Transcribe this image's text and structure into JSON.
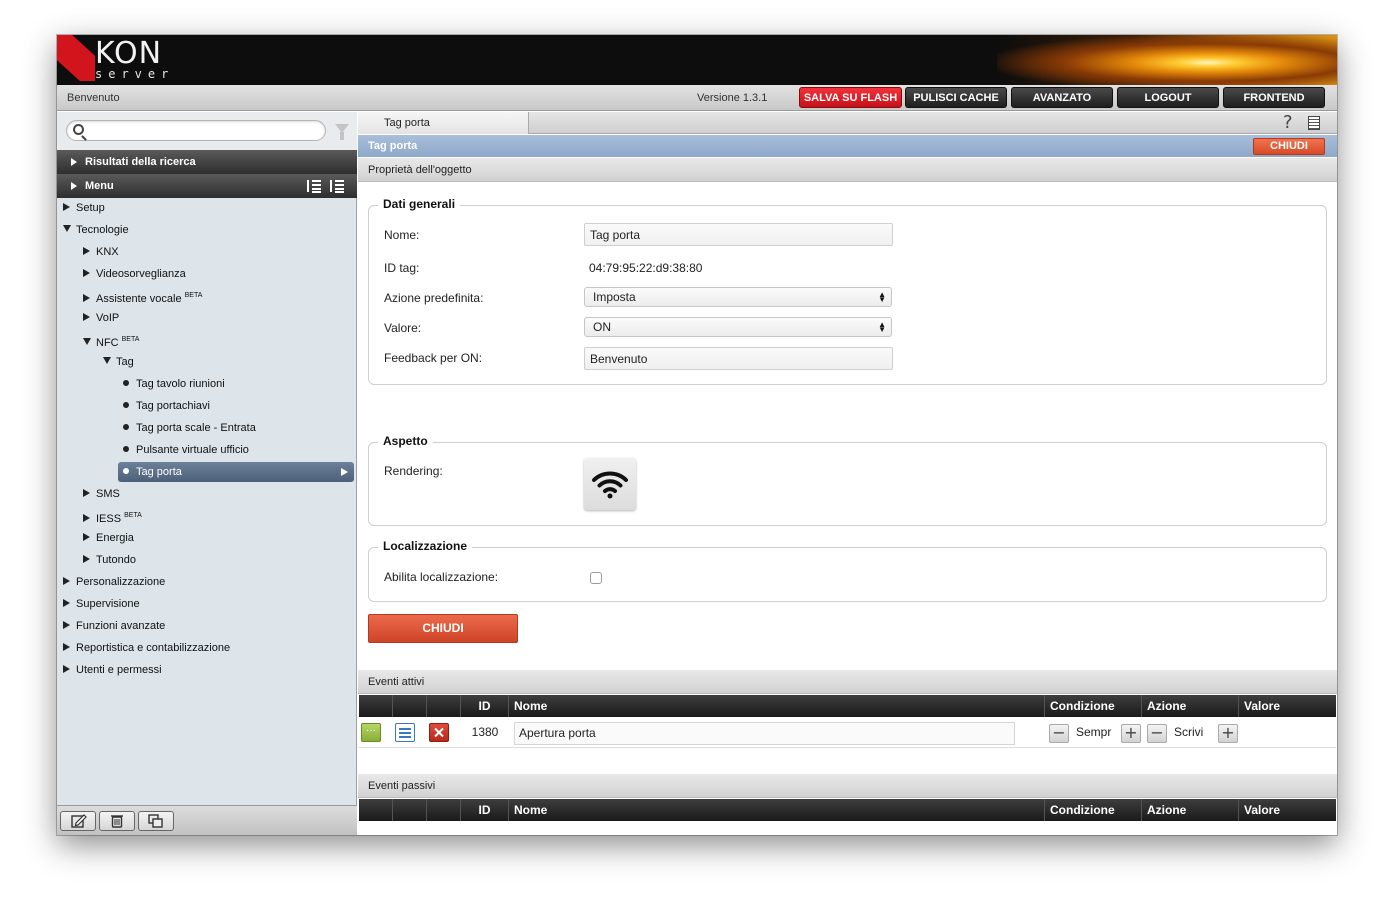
{
  "header": {
    "logo_text": "KON",
    "logo_sub": "server",
    "welcome": "Benvenuto",
    "version": "Versione 1.3.1",
    "buttons": {
      "save_flash": "SALVA SU FLASH",
      "clear_cache": "PULISCI CACHE",
      "advanced": "AVANZATO",
      "logout": "LOGOUT",
      "frontend": "FRONTEND"
    }
  },
  "sidebar": {
    "search_placeholder": "",
    "search_results": "Risultati della ricerca",
    "menu": "Menu",
    "tree": [
      {
        "label": "Setup",
        "sup": ""
      },
      {
        "label": "Tecnologie",
        "sup": ""
      },
      {
        "label": "KNX",
        "sup": ""
      },
      {
        "label": "Videosorveglianza",
        "sup": ""
      },
      {
        "label": "Assistente vocale",
        "sup": "BETA"
      },
      {
        "label": "VoIP",
        "sup": ""
      },
      {
        "label": "NFC",
        "sup": "BETA"
      },
      {
        "label": "Tag",
        "sup": ""
      },
      {
        "label": "Tag tavolo riunioni",
        "sup": ""
      },
      {
        "label": "Tag portachiavi",
        "sup": ""
      },
      {
        "label": "Tag porta scale - Entrata",
        "sup": ""
      },
      {
        "label": "Pulsante virtuale ufficio",
        "sup": ""
      },
      {
        "label": "Tag porta",
        "sup": ""
      },
      {
        "label": "SMS",
        "sup": ""
      },
      {
        "label": "IESS",
        "sup": "BETA"
      },
      {
        "label": "Energia",
        "sup": ""
      },
      {
        "label": "Tutondo",
        "sup": ""
      },
      {
        "label": "Personalizzazione",
        "sup": ""
      },
      {
        "label": "Supervisione",
        "sup": ""
      },
      {
        "label": "Funzioni avanzate",
        "sup": ""
      },
      {
        "label": "Reportistica e contabilizzazione",
        "sup": ""
      },
      {
        "label": "Utenti e permessi",
        "sup": ""
      }
    ]
  },
  "main": {
    "tab": "Tag porta",
    "help": "?",
    "title": "Tag porta",
    "close_small": "CHIUDI",
    "properties": "Proprietà dell'oggetto",
    "general": {
      "legend": "Dati generali",
      "name_label": "Nome:",
      "name_value": "Tag porta",
      "id_label": "ID tag:",
      "id_value": "04:79:95:22:d9:38:80",
      "action_label": "Azione predefinita:",
      "action_value": "Imposta",
      "value_label": "Valore:",
      "value_value": "ON",
      "feedback_label": "Feedback per ON:",
      "feedback_value": "Benvenuto"
    },
    "aspect": {
      "legend": "Aspetto",
      "rendering_label": "Rendering:",
      "rendering_icon": "wifi-icon"
    },
    "location": {
      "legend": "Localizzazione",
      "enable_label": "Abilita localizzazione:",
      "enabled": false
    },
    "close_big": "CHIUDI",
    "active_events": {
      "title": "Eventi attivi",
      "columns": [
        "ID",
        "Nome",
        "Condizione",
        "Azione",
        "Valore"
      ],
      "rows": [
        {
          "id": "1380",
          "name": "Apertura porta",
          "condition": "Sempr",
          "action": "Scrivi",
          "value": ""
        }
      ]
    },
    "passive_events": {
      "title": "Eventi passivi",
      "columns": [
        "ID",
        "Nome",
        "Condizione",
        "Azione",
        "Valore"
      ]
    }
  },
  "colors": {
    "brand_red": "#d2141d",
    "accent_orange": "#d84a28",
    "title_blue": "#8ea8c9",
    "selection": "#4d6079"
  }
}
